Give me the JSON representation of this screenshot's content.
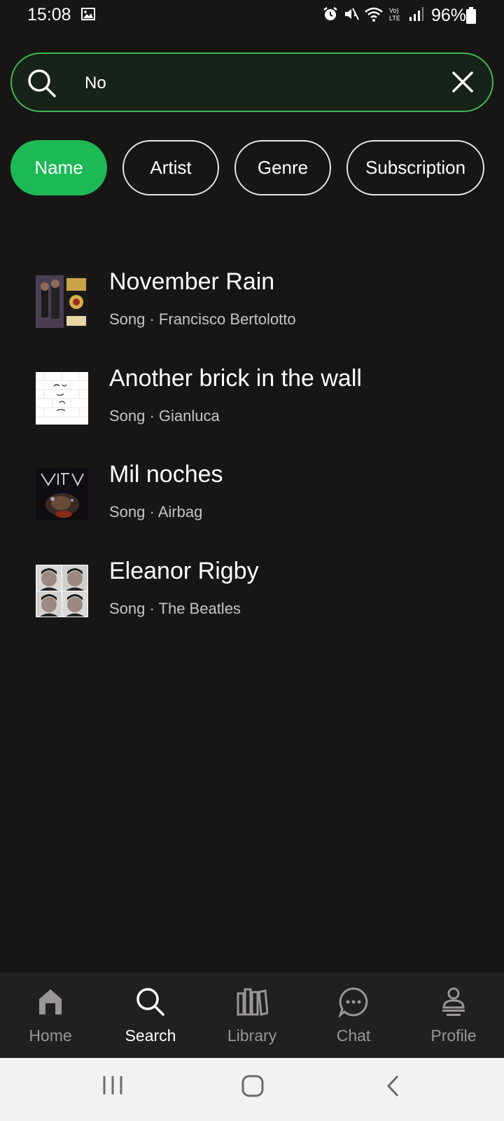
{
  "status_bar": {
    "time": "15:08",
    "battery": "96%",
    "icons": [
      "gallery-icon",
      "alarm-icon",
      "mute-icon",
      "wifi-icon",
      "volte-icon",
      "signal-icon",
      "battery-icon"
    ]
  },
  "search": {
    "value": "No",
    "placeholder": ""
  },
  "filters": [
    {
      "label": "Name",
      "active": true
    },
    {
      "label": "Artist",
      "active": false
    },
    {
      "label": "Genre",
      "active": false
    },
    {
      "label": "Subscription",
      "active": false
    }
  ],
  "results": [
    {
      "title": "November Rain",
      "subtitle": "Song · Francisco Bertolotto"
    },
    {
      "title": "Another brick in the wall",
      "subtitle": "Song · Gianluca"
    },
    {
      "title": "Mil noches",
      "subtitle": "Song · Airbag"
    },
    {
      "title": "Eleanor Rigby",
      "subtitle": "Song · The Beatles"
    }
  ],
  "nav": [
    {
      "label": "Home",
      "icon": "home-icon",
      "active": false
    },
    {
      "label": "Search",
      "icon": "search-icon",
      "active": true
    },
    {
      "label": "Library",
      "icon": "library-icon",
      "active": false
    },
    {
      "label": "Chat",
      "icon": "chat-icon",
      "active": false
    },
    {
      "label": "Profile",
      "icon": "profile-icon",
      "active": false
    }
  ],
  "colors": {
    "background": "#181515",
    "accent": "#1db954",
    "search_border": "#3fb652",
    "nav_background": "#221f1f",
    "inactive_text": "#9a9696"
  }
}
